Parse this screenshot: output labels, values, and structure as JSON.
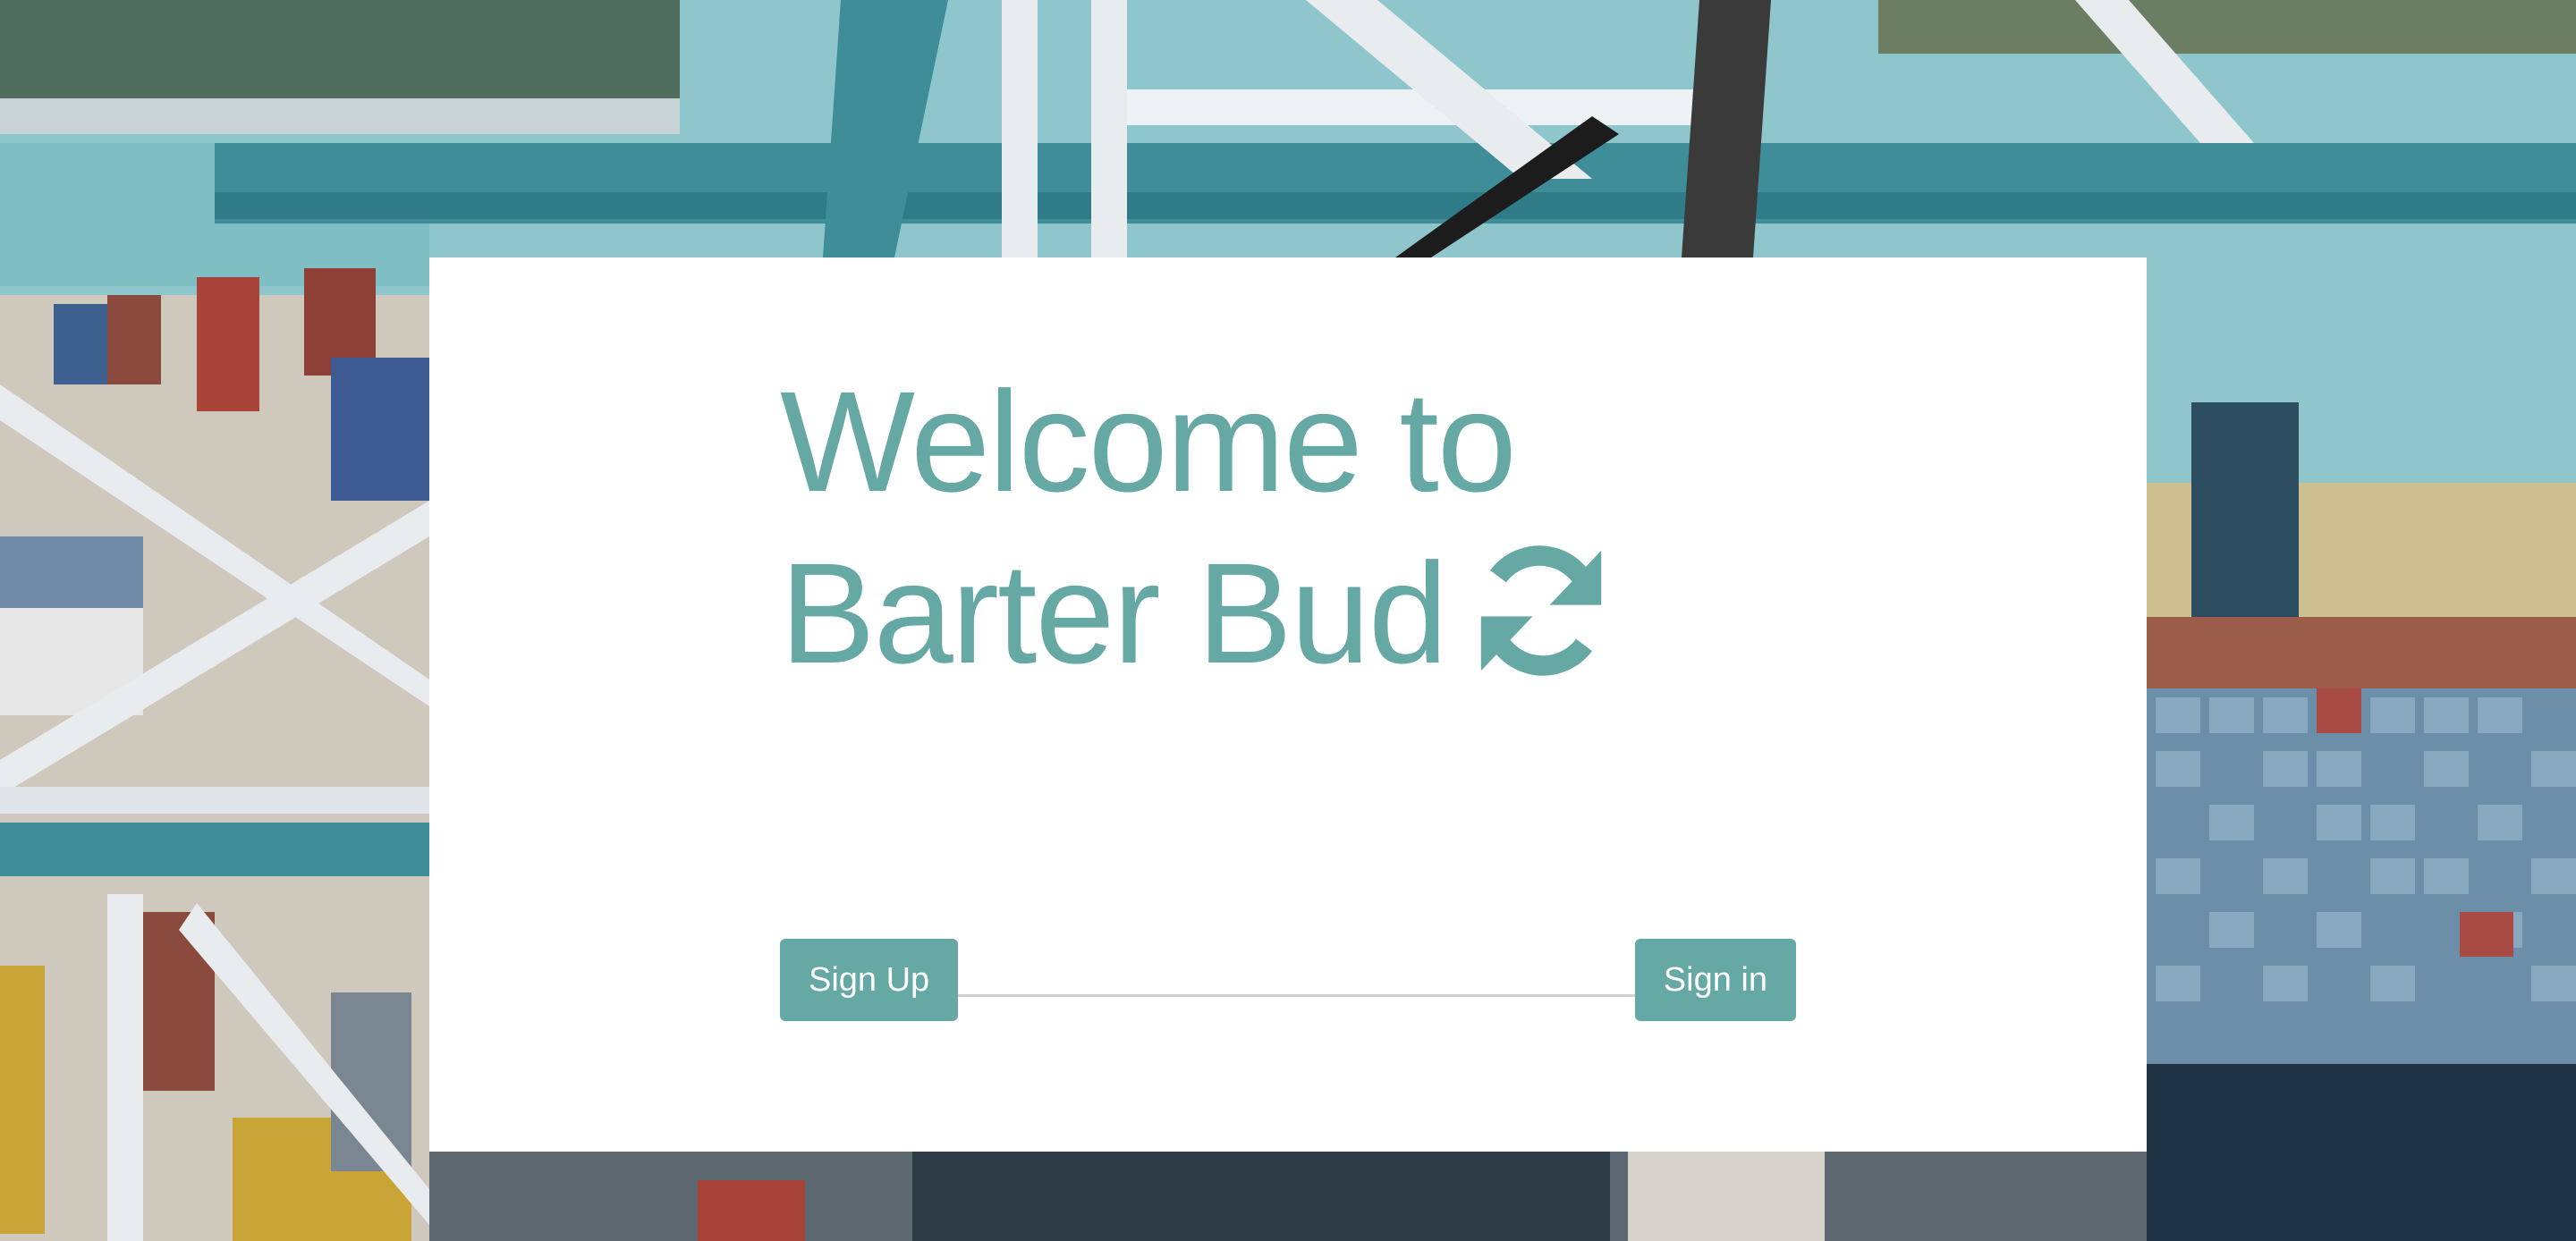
{
  "hero": {
    "title_line1": "Welcome to",
    "title_line2": "Barter Bud",
    "icon": "sync-icon"
  },
  "actions": {
    "signup_label": "Sign Up",
    "signin_label": "Sign in"
  },
  "background": {
    "scene": "container-port-photo"
  },
  "colors": {
    "accent": "#66a8a4",
    "card": "#ffffff",
    "divider": "#cfcfcf"
  }
}
